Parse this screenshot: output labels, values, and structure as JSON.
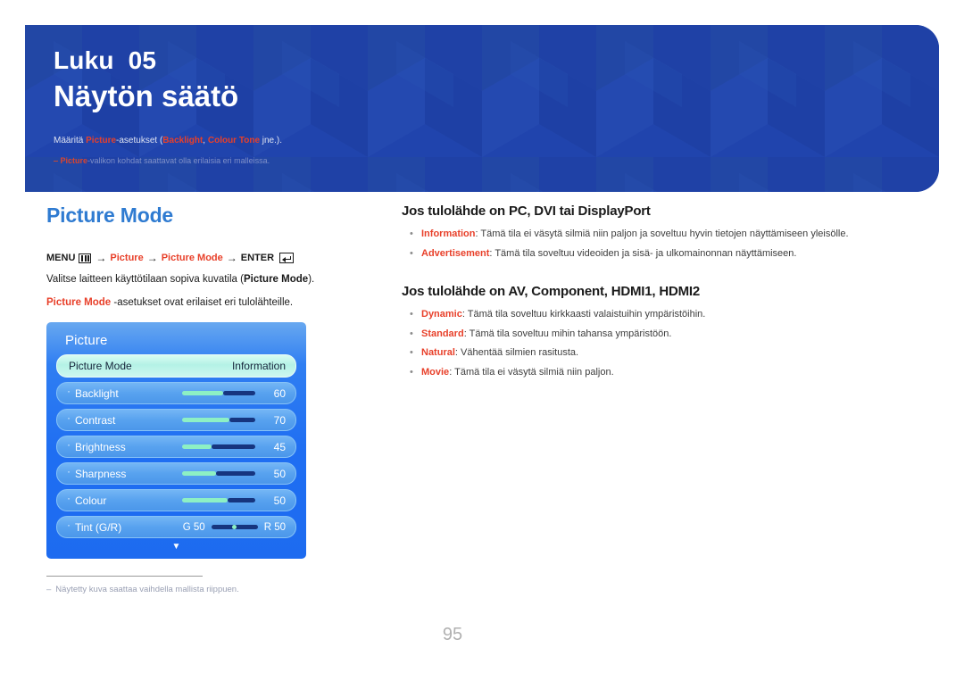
{
  "banner": {
    "chapter_label": "Luku",
    "chapter_number": "05",
    "title": "Näytön säätö",
    "desc_pre": "Määritä ",
    "desc_hl1": "Picture",
    "desc_mid1": "-asetukset (",
    "desc_hl2": "Backlight",
    "desc_mid2": ", ",
    "desc_hl3": "Colour Tone",
    "desc_post": " jne.).",
    "note_dash": "‒",
    "note_hl": "Picture",
    "note_text": "-valikon kohdat saattavat olla erilaisia eri malleissa."
  },
  "left": {
    "section_title": "Picture Mode",
    "menupath": {
      "menu_label": "MENU",
      "menu_icon": "menu-grid-icon",
      "arrow": "→",
      "step1": "Picture",
      "step2": "Picture Mode",
      "enter_label": "ENTER",
      "enter_icon": "enter-return-icon"
    },
    "para1_pre": "Valitse laitteen käyttötilaan sopiva kuvatila (",
    "para1_bold": "Picture Mode",
    "para1_post": ").",
    "para2_bold": "Picture Mode",
    "para2_post": " -asetukset ovat erilaiset eri tulolähteille."
  },
  "osd": {
    "title": "Picture",
    "rows": [
      {
        "label": "Picture Mode",
        "type": "value",
        "value": "Information",
        "selected": true
      },
      {
        "label": "Backlight",
        "type": "slider",
        "value": "60",
        "fill_pct": 56
      },
      {
        "label": "Contrast",
        "type": "slider",
        "value": "70",
        "fill_pct": 66
      },
      {
        "label": "Brightness",
        "type": "slider",
        "value": "45",
        "fill_pct": 40
      },
      {
        "label": "Sharpness",
        "type": "slider",
        "value": "50",
        "fill_pct": 46
      },
      {
        "label": "Colour",
        "type": "slider",
        "value": "50",
        "fill_pct": 62
      },
      {
        "label": "Tint (G/R)",
        "type": "tint",
        "left_value": "G 50",
        "right_value": "R 50"
      }
    ],
    "more_arrow": "▼"
  },
  "footnote": {
    "dash": "‒",
    "text": "Näytetty kuva saattaa vaihdella mallista riippuen."
  },
  "right": {
    "heading1": "Jos tulolähde on PC, DVI tai DisplayPort",
    "bullets1": [
      {
        "bullet": "•",
        "term": "Information",
        "desc": ": Tämä tila ei väsytä silmiä niin paljon ja soveltuu hyvin tietojen näyttämiseen yleisölle."
      },
      {
        "bullet": "•",
        "term": "Advertisement",
        "desc": ": Tämä tila soveltuu videoiden ja sisä- ja ulkomainonnan näyttämiseen."
      }
    ],
    "heading2": "Jos tulolähde on AV, Component, HDMI1, HDMI2",
    "bullets2": [
      {
        "bullet": "•",
        "term": "Dynamic",
        "desc": ": Tämä tila soveltuu kirkkaasti valaistuihin ympäristöihin."
      },
      {
        "bullet": "•",
        "term": "Standard",
        "desc": ": Tämä tila soveltuu mihin tahansa ympäristöön."
      },
      {
        "bullet": "•",
        "term": "Natural",
        "desc": ": Vähentää silmien rasitusta."
      },
      {
        "bullet": "•",
        "term": "Movie",
        "desc": ": Tämä tila ei väsytä silmiä niin paljon."
      }
    ]
  },
  "page_number": "95",
  "colors": {
    "banner_blue": "#2044ad",
    "accent_red": "#e8402a",
    "section_blue": "#2f7bd1",
    "osd_blue": "#1f6ef2",
    "osd_selected": "#b4f2e6",
    "slider_fill": "#8df0c4",
    "slider_rest": "#16357f"
  }
}
